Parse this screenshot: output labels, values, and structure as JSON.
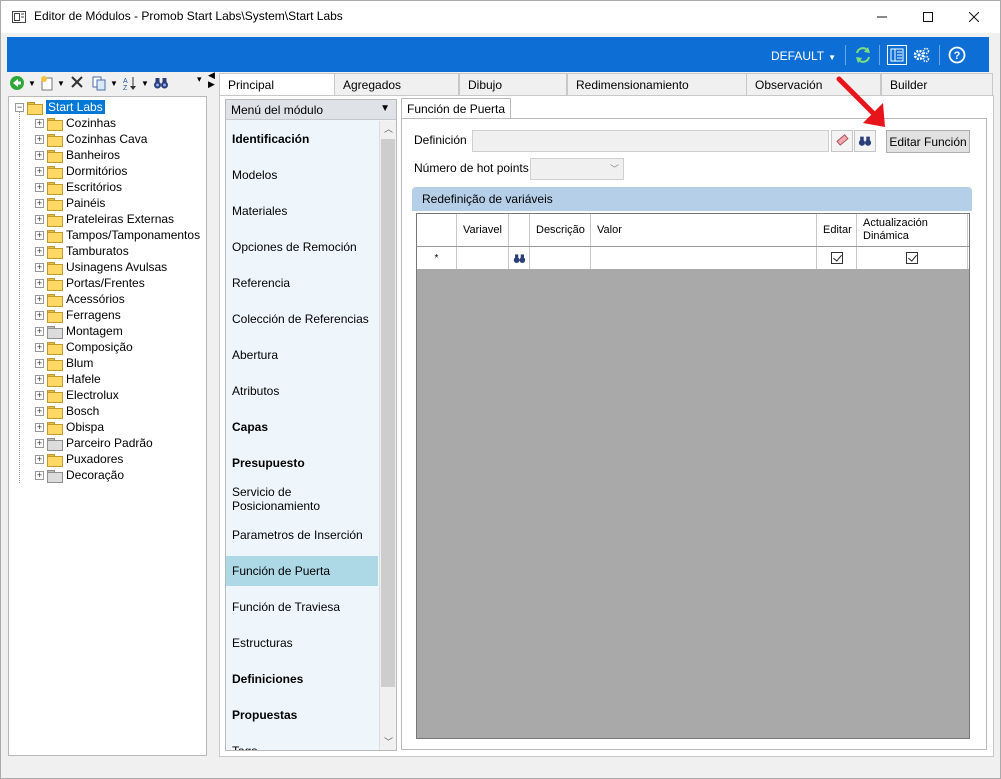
{
  "window": {
    "title": "Editor de Módulos - Promob Start Labs\\System\\Start Labs",
    "controls": [
      "minimize",
      "maximize",
      "close"
    ]
  },
  "toolbar": {
    "profile_label": "DEFAULT"
  },
  "tree": {
    "root": "Start Labs",
    "items": [
      {
        "label": "Cozinhas",
        "gray": false
      },
      {
        "label": "Cozinhas Cava",
        "gray": false
      },
      {
        "label": "Banheiros",
        "gray": false
      },
      {
        "label": "Dormitórios",
        "gray": false
      },
      {
        "label": "Escritórios",
        "gray": false
      },
      {
        "label": "Painéis",
        "gray": false
      },
      {
        "label": "Prateleiras Externas",
        "gray": false
      },
      {
        "label": "Tampos/Tamponamentos",
        "gray": false
      },
      {
        "label": "Tamburatos",
        "gray": false
      },
      {
        "label": "Usinagens Avulsas",
        "gray": false
      },
      {
        "label": "Portas/Frentes",
        "gray": false
      },
      {
        "label": "Acessórios",
        "gray": false
      },
      {
        "label": "Ferragens",
        "gray": false
      },
      {
        "label": "Montagem",
        "gray": true
      },
      {
        "label": "Composição",
        "gray": false
      },
      {
        "label": "Blum",
        "gray": false
      },
      {
        "label": "Hafele",
        "gray": false
      },
      {
        "label": "Electrolux",
        "gray": false
      },
      {
        "label": "Bosch",
        "gray": false
      },
      {
        "label": "Obispa",
        "gray": false
      },
      {
        "label": "Parceiro Padrão",
        "gray": true
      },
      {
        "label": "Puxadores",
        "gray": false
      },
      {
        "label": "Decoração",
        "gray": true
      }
    ]
  },
  "tabs": [
    "Principal",
    "Agregados",
    "Dibujo",
    "Redimensionamiento",
    "Observación",
    "Builder"
  ],
  "menu": {
    "header": "Menú del módulo",
    "items": [
      {
        "label": "Identificación",
        "bold": true
      },
      {
        "label": "Modelos",
        "bold": false
      },
      {
        "label": "Materiales",
        "bold": false
      },
      {
        "label": "Opciones de Remoción",
        "bold": false
      },
      {
        "label": "Referencia",
        "bold": false
      },
      {
        "label": "Colección de Referencias",
        "bold": false
      },
      {
        "label": "Abertura",
        "bold": false
      },
      {
        "label": "Atributos",
        "bold": false
      },
      {
        "label": "Capas",
        "bold": true
      },
      {
        "label": "Presupuesto",
        "bold": true
      },
      {
        "label": "Servicio de Posicionamiento",
        "bold": false
      },
      {
        "label": "Parametros de Inserción",
        "bold": false
      },
      {
        "label": "Función de Puerta",
        "bold": false,
        "selected": true
      },
      {
        "label": "Función de Traviesa",
        "bold": false
      },
      {
        "label": "Estructuras",
        "bold": false
      },
      {
        "label": "Definiciones",
        "bold": true
      },
      {
        "label": "Propuestas",
        "bold": true
      },
      {
        "label": "Tags",
        "bold": false
      }
    ]
  },
  "door_function": {
    "tab_label": "Función de Puerta",
    "definition_label": "Definición",
    "definition_value": "",
    "edit_button": "Editar Función",
    "hotpoints_label": "Número de hot points",
    "hotpoints_value": "",
    "group_title": "Redefinição de variáveis",
    "grid": {
      "columns": [
        "Variavel",
        "",
        "Descrição",
        "Valor",
        "Editar",
        "Actualización Dinámica"
      ],
      "new_row_marker": "*"
    }
  },
  "colors": {
    "accent_bar": "#0d6fd6",
    "selection": "#add8e6",
    "annotation_arrow": "#e8141b"
  }
}
